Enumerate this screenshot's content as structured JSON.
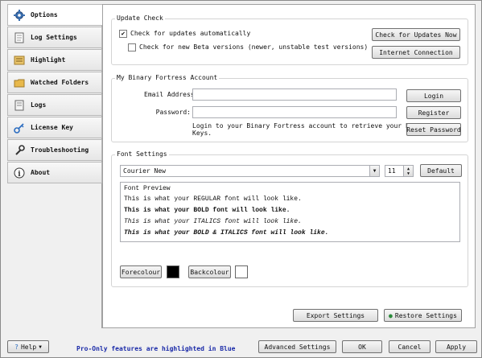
{
  "sidebar": {
    "items": [
      {
        "label": "Options",
        "icon": "gear-icon",
        "active": true
      },
      {
        "label": "Log Settings",
        "icon": "document-icon"
      },
      {
        "label": "Highlight",
        "icon": "highlight-icon"
      },
      {
        "label": "Watched Folders",
        "icon": "folder-icon"
      },
      {
        "label": "Logs",
        "icon": "log-icon"
      },
      {
        "label": "License Key",
        "icon": "key-icon"
      },
      {
        "label": "Troubleshooting",
        "icon": "wrench-icon"
      },
      {
        "label": "About",
        "icon": "info-icon"
      }
    ]
  },
  "update_check": {
    "title": "Update Check",
    "auto_label": "Check for updates automatically",
    "auto_checked": true,
    "beta_label": "Check for new Beta versions (newer, unstable test versions)",
    "beta_checked": false,
    "check_now_button": "Check for Updates Now",
    "internet_button": "Internet Connection"
  },
  "account": {
    "title": "My Binary Fortress Account",
    "email_label": "Email Address:",
    "email_value": "",
    "password_label": "Password:",
    "password_value": "",
    "login_button": "Login",
    "register_button": "Register",
    "reset_button": "Reset Password",
    "info_line1": "Login to your Binary Fortress account to retrieve your License",
    "info_line2": "Keys."
  },
  "font_settings": {
    "title": "Font Settings",
    "font_name": "Courier New",
    "font_size": "11",
    "default_button": "Default",
    "preview_header": "Font Preview",
    "preview_regular": "This is what your REGULAR font will look like.",
    "preview_bold": "This is what your BOLD font will look like.",
    "preview_italic": "This is what your ITALICS font will look like.",
    "preview_bold_italic": "This is what your BOLD & ITALICS font will look like.",
    "forecolour_button": "Forecolour",
    "backcolour_button": "Backcolour",
    "forecolour": "#000000",
    "backcolour": "#ffffff"
  },
  "settings_buttons": {
    "export": "Export Settings",
    "restore": "Restore Settings"
  },
  "footer": {
    "help_button": "Help",
    "pro_note": "Pro-Only features are highlighted in Blue",
    "advanced_button": "Advanced Settings",
    "ok_button": "OK",
    "cancel_button": "Cancel",
    "apply_button": "Apply"
  }
}
